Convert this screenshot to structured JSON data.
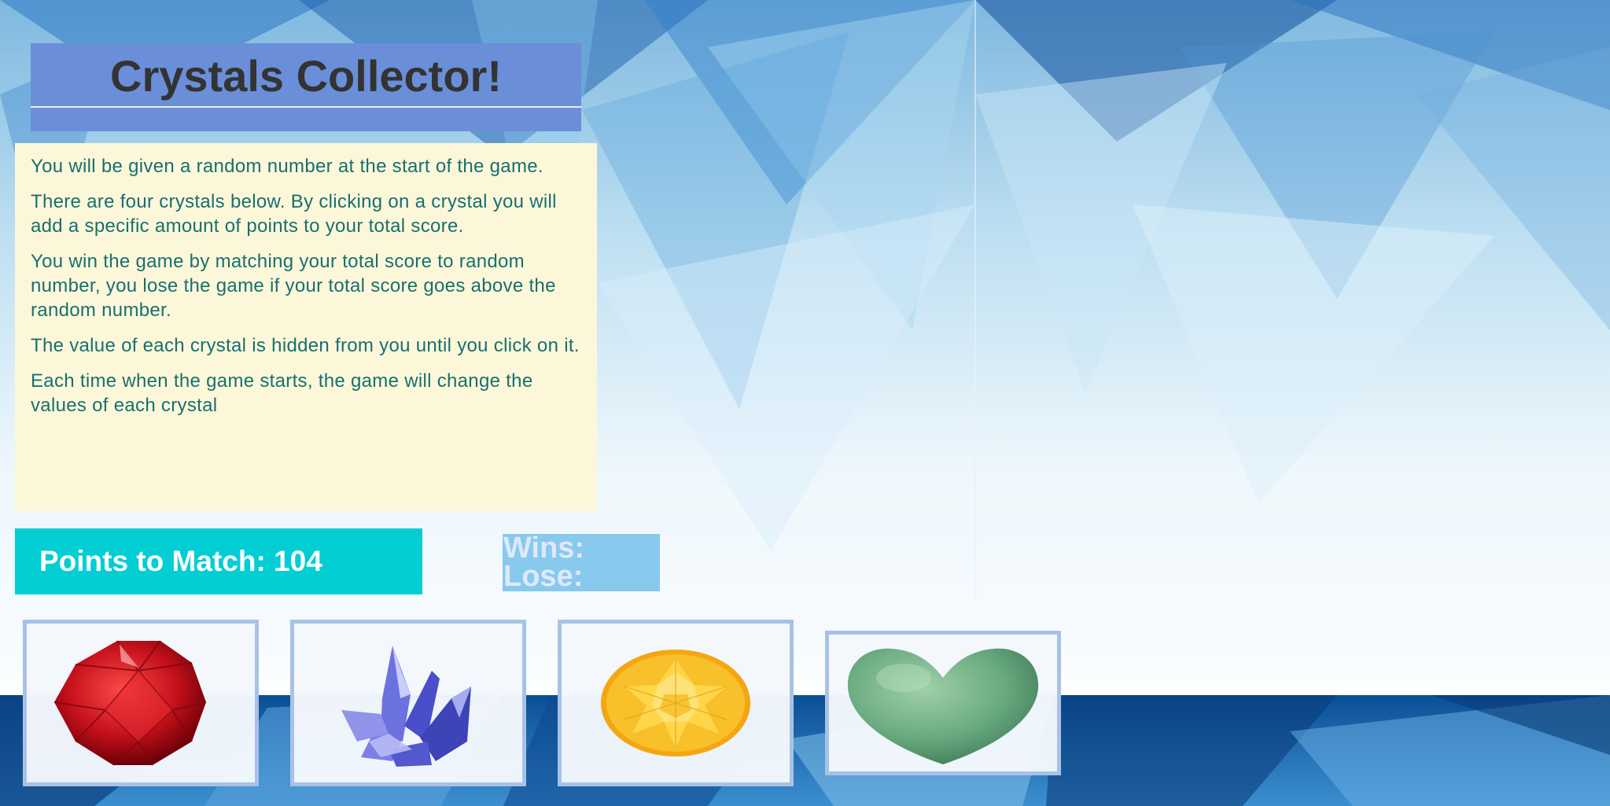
{
  "header": {
    "title": "Crystals Collector!"
  },
  "instructions": [
    "You will be given a random number at the start of the game.",
    "There are four crystals below. By clicking on a crystal you will add a specific amount of points to your total score.",
    "You win the game by matching your total score to random number, you lose the game if your total score goes above the random number.",
    "The value of each crystal is hidden from you until you click on it.",
    "Each time when the game starts, the game will change the values of each crystal"
  ],
  "target": {
    "label": "Points to Match: 104"
  },
  "scoreboard": {
    "wins_label": "Wins:",
    "lose_label": "Lose:"
  },
  "crystals": [
    {
      "name": "red faceted crystal",
      "icon": "red-crystal-icon",
      "color": "#c4101a"
    },
    {
      "name": "purple crystal cluster",
      "icon": "purple-crystal-icon",
      "color": "#5a5fd6"
    },
    {
      "name": "yellow round gem",
      "icon": "yellow-gem-icon",
      "color": "#f6b21a"
    },
    {
      "name": "green heart stone",
      "icon": "green-heart-icon",
      "color": "#6aaa80"
    }
  ],
  "colors": {
    "title_bar": "#6a8fd8",
    "instructions_bg": "#fdf7da",
    "instructions_text": "#17706f",
    "points_bg": "#02ced3",
    "score_bg": "#88c9ee"
  }
}
